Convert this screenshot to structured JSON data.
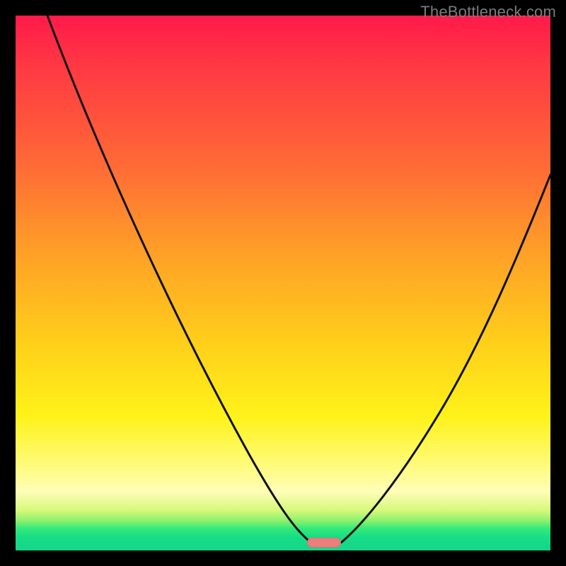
{
  "watermark": "TheBottleneck.com",
  "colors": {
    "frame": "#000000",
    "curve": "#111111",
    "marker": "#eb7f7b",
    "watermark": "#7c7c7c"
  },
  "chart_data": {
    "type": "line",
    "title": "",
    "xlabel": "",
    "ylabel": "",
    "xlim": [
      0,
      100
    ],
    "ylim": [
      0,
      100
    ],
    "series": [
      {
        "name": "left-curve",
        "x": [
          6,
          10,
          15,
          20,
          25,
          30,
          35,
          40,
          45,
          50,
          54,
          56
        ],
        "y": [
          100,
          92,
          82,
          72,
          62,
          52,
          42,
          32,
          22,
          12,
          4,
          1
        ]
      },
      {
        "name": "right-curve",
        "x": [
          60,
          64,
          70,
          76,
          82,
          88,
          94,
          100
        ],
        "y": [
          1,
          4,
          12,
          22,
          34,
          46,
          58,
          70
        ]
      }
    ],
    "marker": {
      "x": 57,
      "y": 0,
      "shape": "pill"
    },
    "gradient_stops": [
      {
        "pos": 0,
        "color": "#ff1a4a"
      },
      {
        "pos": 0.28,
        "color": "#ff6a36"
      },
      {
        "pos": 0.62,
        "color": "#ffd11a"
      },
      {
        "pos": 0.89,
        "color": "#fffdb8"
      },
      {
        "pos": 0.96,
        "color": "#2fe97a"
      },
      {
        "pos": 1.0,
        "color": "#14d68a"
      }
    ]
  }
}
